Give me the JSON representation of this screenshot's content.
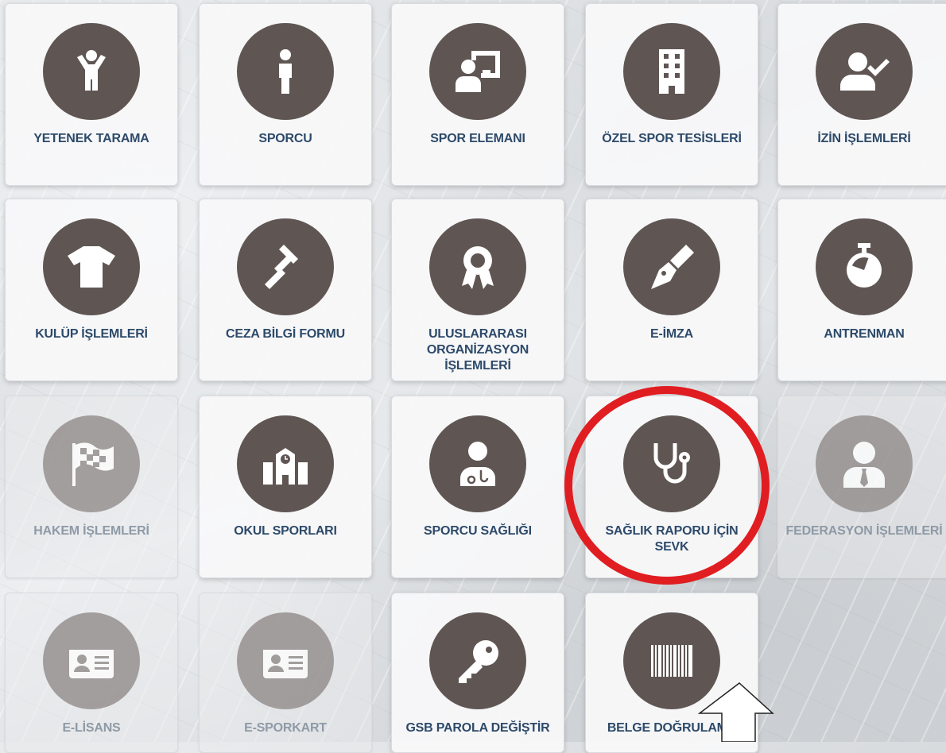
{
  "tiles": [
    {
      "label": "YETENEK TARAMA",
      "icon": "child-icon"
    },
    {
      "label": "SPORCU",
      "icon": "person-info-icon"
    },
    {
      "label": "SPOR ELEMANI",
      "icon": "teacher-board-icon"
    },
    {
      "label": "ÖZEL SPOR TESİSLERİ",
      "icon": "building-icon"
    },
    {
      "label": "İZİN İŞLEMLERİ",
      "icon": "user-check-icon"
    },
    {
      "label": "KULÜP İŞLEMLERİ",
      "icon": "tshirt-icon"
    },
    {
      "label": "CEZA BİLGİ FORMU",
      "icon": "gavel-icon"
    },
    {
      "label": "ULUSLARARASI ORGANİZASYON İŞLEMLERİ",
      "icon": "award-icon"
    },
    {
      "label": "E-İMZA",
      "icon": "pen-nib-icon"
    },
    {
      "label": "ANTRENMAN",
      "icon": "stopwatch-icon"
    },
    {
      "label": "HAKEM İŞLEMLERİ",
      "icon": "checkered-flag-icon"
    },
    {
      "label": "OKUL SPORLARI",
      "icon": "school-icon"
    },
    {
      "label": "SPORCU SAĞLIĞI",
      "icon": "user-doctor-icon"
    },
    {
      "label": "SAĞLIK RAPORU İÇİN SEVK",
      "icon": "stethoscope-icon"
    },
    {
      "label": "FEDERASYON İŞLEMLERİ",
      "icon": "user-tie-icon"
    },
    {
      "label": "E-LİSANS",
      "icon": "id-card-icon"
    },
    {
      "label": "E-SPORKART",
      "icon": "id-card-icon"
    },
    {
      "label": "GSB PAROLA DEĞİŞTİR",
      "icon": "key-icon"
    },
    {
      "label": "BELGE DOĞRULAMA",
      "icon": "barcode-icon"
    }
  ],
  "highlighted_tile": "SAĞLIK RAPORU İÇİN SEVK",
  "colors": {
    "icon_circle": "#5f5653",
    "label": "#2d4a6a",
    "highlight": "#e01e22"
  }
}
